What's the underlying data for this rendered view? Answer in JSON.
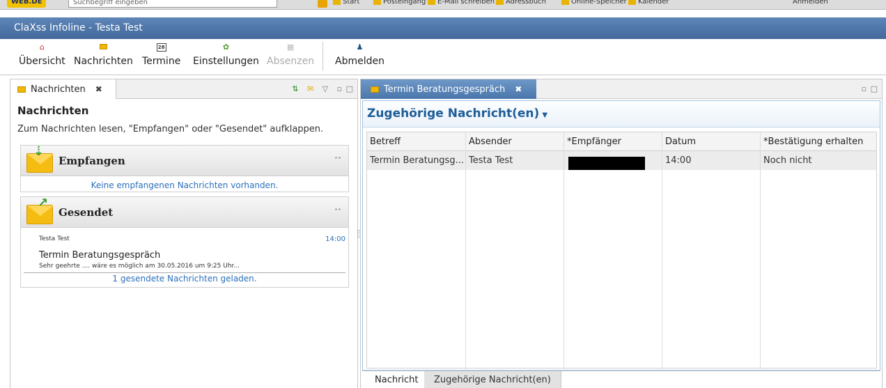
{
  "browser": {
    "logo": "WEB.DE",
    "search_placeholder": "Suchbegriff eingeben",
    "bookmarks": [
      "Start",
      "Posteingang",
      "E-Mail schreiben",
      "Adressbuch",
      "Online-Speicher",
      "Kalender"
    ],
    "login": "Anmelden"
  },
  "app": {
    "title": "ClaXss Infoline - Testa Test"
  },
  "toolbar": {
    "overview": "Übersicht",
    "messages": "Nachrichten",
    "appointments": "Termine",
    "settings": "Einstellungen",
    "absences": "Absenzen",
    "logout": "Abmelden",
    "calendar_day": "28"
  },
  "left": {
    "tab_label": "Nachrichten",
    "heading": "Nachrichten",
    "hint": "Zum Nachrichten lesen, \"Empfangen\" oder \"Gesendet\" aufklappen.",
    "received": {
      "title": "Empfangen",
      "empty": "Keine empfangenen Nachrichten vorhanden."
    },
    "sent": {
      "title": "Gesendet",
      "sender": "Testa Test",
      "time": "14:00",
      "subject": "Termin Beratungsgespräch",
      "preview": "Sehr geehrte .... wäre es möglich am 30.05.2016 um 9:25 Uhr...",
      "footer": "1 gesendete Nachrichten geladen."
    }
  },
  "right": {
    "tab_label": "Termin Beratungsgespräch",
    "header": "Zugehörige Nachricht(en)",
    "columns": [
      "Betreff",
      "Absender",
      "*Empfänger",
      "Datum",
      "*Bestätigung erhalten"
    ],
    "rows": [
      {
        "subject": "Termin Beratungsg...",
        "sender": "Testa Test",
        "date": "14:00",
        "confirmation": "Noch nicht"
      }
    ],
    "bottom_tabs": [
      "Nachricht",
      "Zugehörige Nachricht(en)"
    ]
  },
  "colors": {
    "title_bar": "#4a72a6",
    "accent_blue": "#1f5d99",
    "link_blue": "#2b6fbc",
    "envelope": "#f0b800"
  }
}
